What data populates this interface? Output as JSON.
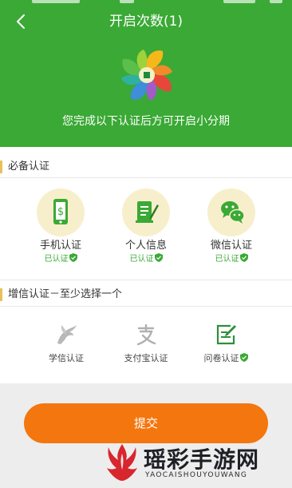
{
  "header": {
    "title": "开启次数(1)",
    "subtitle": "您完成以下认证后方可开启小分期"
  },
  "icons": {
    "back": "chevron-left-icon",
    "logo": "pinwheel-coin-logo"
  },
  "required": {
    "title": "必备认证",
    "items": [
      {
        "label": "手机认证",
        "status": "已认证",
        "icon": "phone-dollar-icon"
      },
      {
        "label": "个人信息",
        "status": "已认证",
        "icon": "document-pen-icon"
      },
      {
        "label": "微信认证",
        "status": "已认证",
        "icon": "wechat-icon"
      }
    ]
  },
  "optional": {
    "title": "增信认证－至少选择一个",
    "items": [
      {
        "label": "学信认证",
        "icon": "bird-icon"
      },
      {
        "label": "支付宝认证",
        "icon": "alipay-icon"
      },
      {
        "label": "问卷认证",
        "icon": "questionnaire-icon",
        "verified": true
      }
    ]
  },
  "submit": {
    "label": "提交"
  },
  "watermark": {
    "text": "瑶彩手游网",
    "sub": "YAOCAISHOUYOUWANG"
  },
  "colors": {
    "primary_green": "#3aa935",
    "submit_orange": "#f4760f",
    "section_accent": "#e8c15a",
    "icon_circle": "#f7efcb"
  }
}
